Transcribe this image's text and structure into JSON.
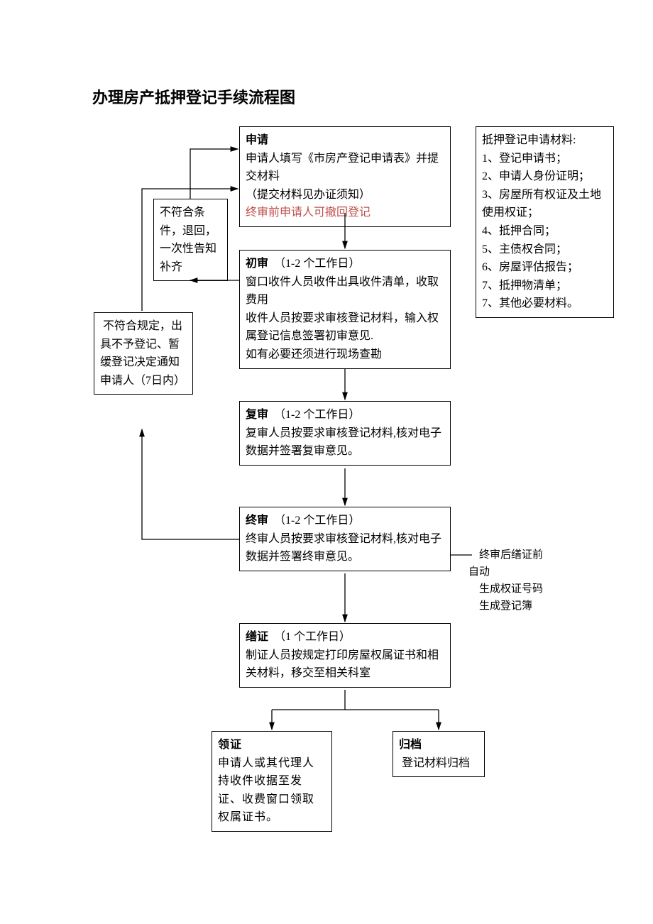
{
  "title": "办理房产抵押登记手续流程图",
  "apply": {
    "head": "申请",
    "l1": "申请人填写《市房产登记申请表》并提交材料",
    "l2": "（提交材料见办证须知）",
    "l3": "终审前申请人可撤回登记"
  },
  "first": {
    "head": "初审",
    "dur": "（1-2 个工作日）",
    "l1": "窗口收件人员收件出具收件清单，收取费用",
    "l2": "收件人员按要求审核登记材料，输入权属登记信息签署初审意见.",
    "l3": "如有必要还须进行现场查勘"
  },
  "review": {
    "head": "复审",
    "dur": "（1-2 个工作日）",
    "l1": "复审人员按要求审核登记材料,核对电子数据并签署复审意见。"
  },
  "final": {
    "head": "终审",
    "dur": "（1-2 个工作日）",
    "l1": "终审人员按要求审核登记材料,核对电子数据并签署终审意见。"
  },
  "issue": {
    "head": "缮证",
    "dur": "（1 个工作日）",
    "l1": "制证人员按规定打印房屋权属证书和相关材料，移交至相关科室"
  },
  "get": {
    "head": "领证",
    "l1": "申请人或其代理人持收件收据至发证、收费窗口领取权属证书。"
  },
  "arch": {
    "head": "归档",
    "l1": " 登记材料归档"
  },
  "rej1": "不符合条件，退回，一次性告知补齐",
  "rej2": " 不符合规定，出具不予登记、暂缓登记决定通知申请人（7日内）",
  "mat": {
    "head": "抵押登记申请材料:",
    "i1": "1、登记申请书；",
    "i2": "2、申请人身份证明；",
    "i3": "3、房屋所有权证及土地使用权证；",
    "i4": "4、抵押合同；",
    "i5": "5、主债权合同；",
    "i6": "6、房屋评估报告；",
    "i7": "7、抵押物清单；",
    "i8": "7、其他必要材料。"
  },
  "note": {
    "l1": "终审后缮证前",
    "l2": "自动",
    "l3": "生成权证号码",
    "l4": "生成登记簿"
  }
}
